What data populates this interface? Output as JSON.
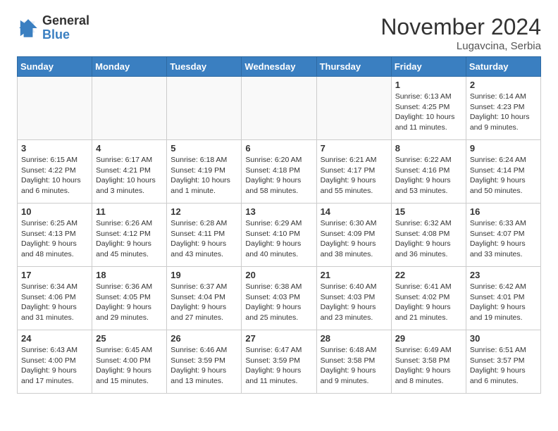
{
  "header": {
    "logo_general": "General",
    "logo_blue": "Blue",
    "month_title": "November 2024",
    "location": "Lugavcina, Serbia"
  },
  "weekdays": [
    "Sunday",
    "Monday",
    "Tuesday",
    "Wednesday",
    "Thursday",
    "Friday",
    "Saturday"
  ],
  "weeks": [
    [
      {
        "day": "",
        "info": ""
      },
      {
        "day": "",
        "info": ""
      },
      {
        "day": "",
        "info": ""
      },
      {
        "day": "",
        "info": ""
      },
      {
        "day": "",
        "info": ""
      },
      {
        "day": "1",
        "info": "Sunrise: 6:13 AM\nSunset: 4:25 PM\nDaylight: 10 hours and 11 minutes."
      },
      {
        "day": "2",
        "info": "Sunrise: 6:14 AM\nSunset: 4:23 PM\nDaylight: 10 hours and 9 minutes."
      }
    ],
    [
      {
        "day": "3",
        "info": "Sunrise: 6:15 AM\nSunset: 4:22 PM\nDaylight: 10 hours and 6 minutes."
      },
      {
        "day": "4",
        "info": "Sunrise: 6:17 AM\nSunset: 4:21 PM\nDaylight: 10 hours and 3 minutes."
      },
      {
        "day": "5",
        "info": "Sunrise: 6:18 AM\nSunset: 4:19 PM\nDaylight: 10 hours and 1 minute."
      },
      {
        "day": "6",
        "info": "Sunrise: 6:20 AM\nSunset: 4:18 PM\nDaylight: 9 hours and 58 minutes."
      },
      {
        "day": "7",
        "info": "Sunrise: 6:21 AM\nSunset: 4:17 PM\nDaylight: 9 hours and 55 minutes."
      },
      {
        "day": "8",
        "info": "Sunrise: 6:22 AM\nSunset: 4:16 PM\nDaylight: 9 hours and 53 minutes."
      },
      {
        "day": "9",
        "info": "Sunrise: 6:24 AM\nSunset: 4:14 PM\nDaylight: 9 hours and 50 minutes."
      }
    ],
    [
      {
        "day": "10",
        "info": "Sunrise: 6:25 AM\nSunset: 4:13 PM\nDaylight: 9 hours and 48 minutes."
      },
      {
        "day": "11",
        "info": "Sunrise: 6:26 AM\nSunset: 4:12 PM\nDaylight: 9 hours and 45 minutes."
      },
      {
        "day": "12",
        "info": "Sunrise: 6:28 AM\nSunset: 4:11 PM\nDaylight: 9 hours and 43 minutes."
      },
      {
        "day": "13",
        "info": "Sunrise: 6:29 AM\nSunset: 4:10 PM\nDaylight: 9 hours and 40 minutes."
      },
      {
        "day": "14",
        "info": "Sunrise: 6:30 AM\nSunset: 4:09 PM\nDaylight: 9 hours and 38 minutes."
      },
      {
        "day": "15",
        "info": "Sunrise: 6:32 AM\nSunset: 4:08 PM\nDaylight: 9 hours and 36 minutes."
      },
      {
        "day": "16",
        "info": "Sunrise: 6:33 AM\nSunset: 4:07 PM\nDaylight: 9 hours and 33 minutes."
      }
    ],
    [
      {
        "day": "17",
        "info": "Sunrise: 6:34 AM\nSunset: 4:06 PM\nDaylight: 9 hours and 31 minutes."
      },
      {
        "day": "18",
        "info": "Sunrise: 6:36 AM\nSunset: 4:05 PM\nDaylight: 9 hours and 29 minutes."
      },
      {
        "day": "19",
        "info": "Sunrise: 6:37 AM\nSunset: 4:04 PM\nDaylight: 9 hours and 27 minutes."
      },
      {
        "day": "20",
        "info": "Sunrise: 6:38 AM\nSunset: 4:03 PM\nDaylight: 9 hours and 25 minutes."
      },
      {
        "day": "21",
        "info": "Sunrise: 6:40 AM\nSunset: 4:03 PM\nDaylight: 9 hours and 23 minutes."
      },
      {
        "day": "22",
        "info": "Sunrise: 6:41 AM\nSunset: 4:02 PM\nDaylight: 9 hours and 21 minutes."
      },
      {
        "day": "23",
        "info": "Sunrise: 6:42 AM\nSunset: 4:01 PM\nDaylight: 9 hours and 19 minutes."
      }
    ],
    [
      {
        "day": "24",
        "info": "Sunrise: 6:43 AM\nSunset: 4:00 PM\nDaylight: 9 hours and 17 minutes."
      },
      {
        "day": "25",
        "info": "Sunrise: 6:45 AM\nSunset: 4:00 PM\nDaylight: 9 hours and 15 minutes."
      },
      {
        "day": "26",
        "info": "Sunrise: 6:46 AM\nSunset: 3:59 PM\nDaylight: 9 hours and 13 minutes."
      },
      {
        "day": "27",
        "info": "Sunrise: 6:47 AM\nSunset: 3:59 PM\nDaylight: 9 hours and 11 minutes."
      },
      {
        "day": "28",
        "info": "Sunrise: 6:48 AM\nSunset: 3:58 PM\nDaylight: 9 hours and 9 minutes."
      },
      {
        "day": "29",
        "info": "Sunrise: 6:49 AM\nSunset: 3:58 PM\nDaylight: 9 hours and 8 minutes."
      },
      {
        "day": "30",
        "info": "Sunrise: 6:51 AM\nSunset: 3:57 PM\nDaylight: 9 hours and 6 minutes."
      }
    ]
  ]
}
